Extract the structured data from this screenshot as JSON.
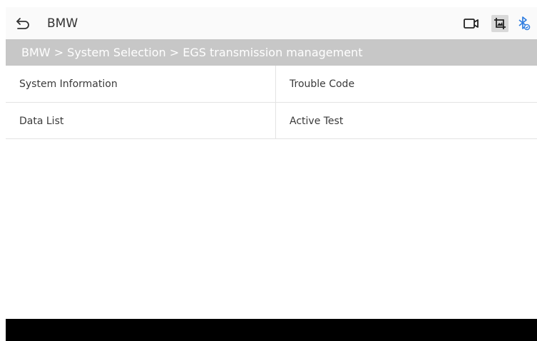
{
  "header": {
    "title": "BMW",
    "icons": {
      "back": "back-arrow-icon",
      "camera": "video-camera-icon",
      "screenshot": "screenshot-crop-icon",
      "bluetooth": "bluetooth-connected-icon"
    },
    "colors": {
      "bluetooth": "#2f7de0",
      "screenshot_bg": "#d9d9d9"
    }
  },
  "breadcrumb": {
    "text": "BMW > System Selection > EGS transmission management",
    "background": "#c7c7c7"
  },
  "functions": [
    {
      "label": "System Information"
    },
    {
      "label": "Trouble Code"
    },
    {
      "label": "Data List"
    },
    {
      "label": "Active Test"
    }
  ]
}
